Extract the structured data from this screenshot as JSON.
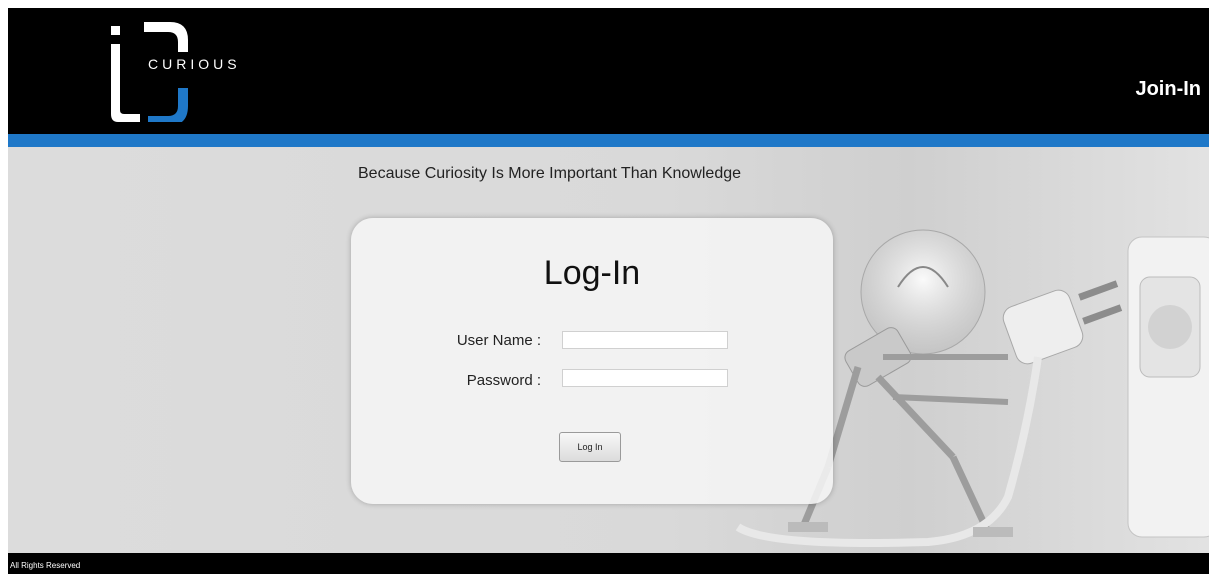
{
  "header": {
    "logo_text": "CURIOUS",
    "join_label": "Join-In"
  },
  "tagline": "Because Curiosity Is More Important Than Knowledge",
  "login": {
    "title": "Log-In",
    "username_label": "User Name :",
    "username_value": "",
    "password_label": "Password :",
    "password_value": "",
    "button_label": "Log In"
  },
  "footer": {
    "text": "All Rights Reserved"
  },
  "colors": {
    "header_bg": "#000000",
    "accent_blue": "#1f78c8",
    "page_bg": "#dcdcdc"
  },
  "icons": {
    "logo": "ic-curious-logo-icon",
    "illustration": "lightbulb-robot-plug-illustration"
  }
}
